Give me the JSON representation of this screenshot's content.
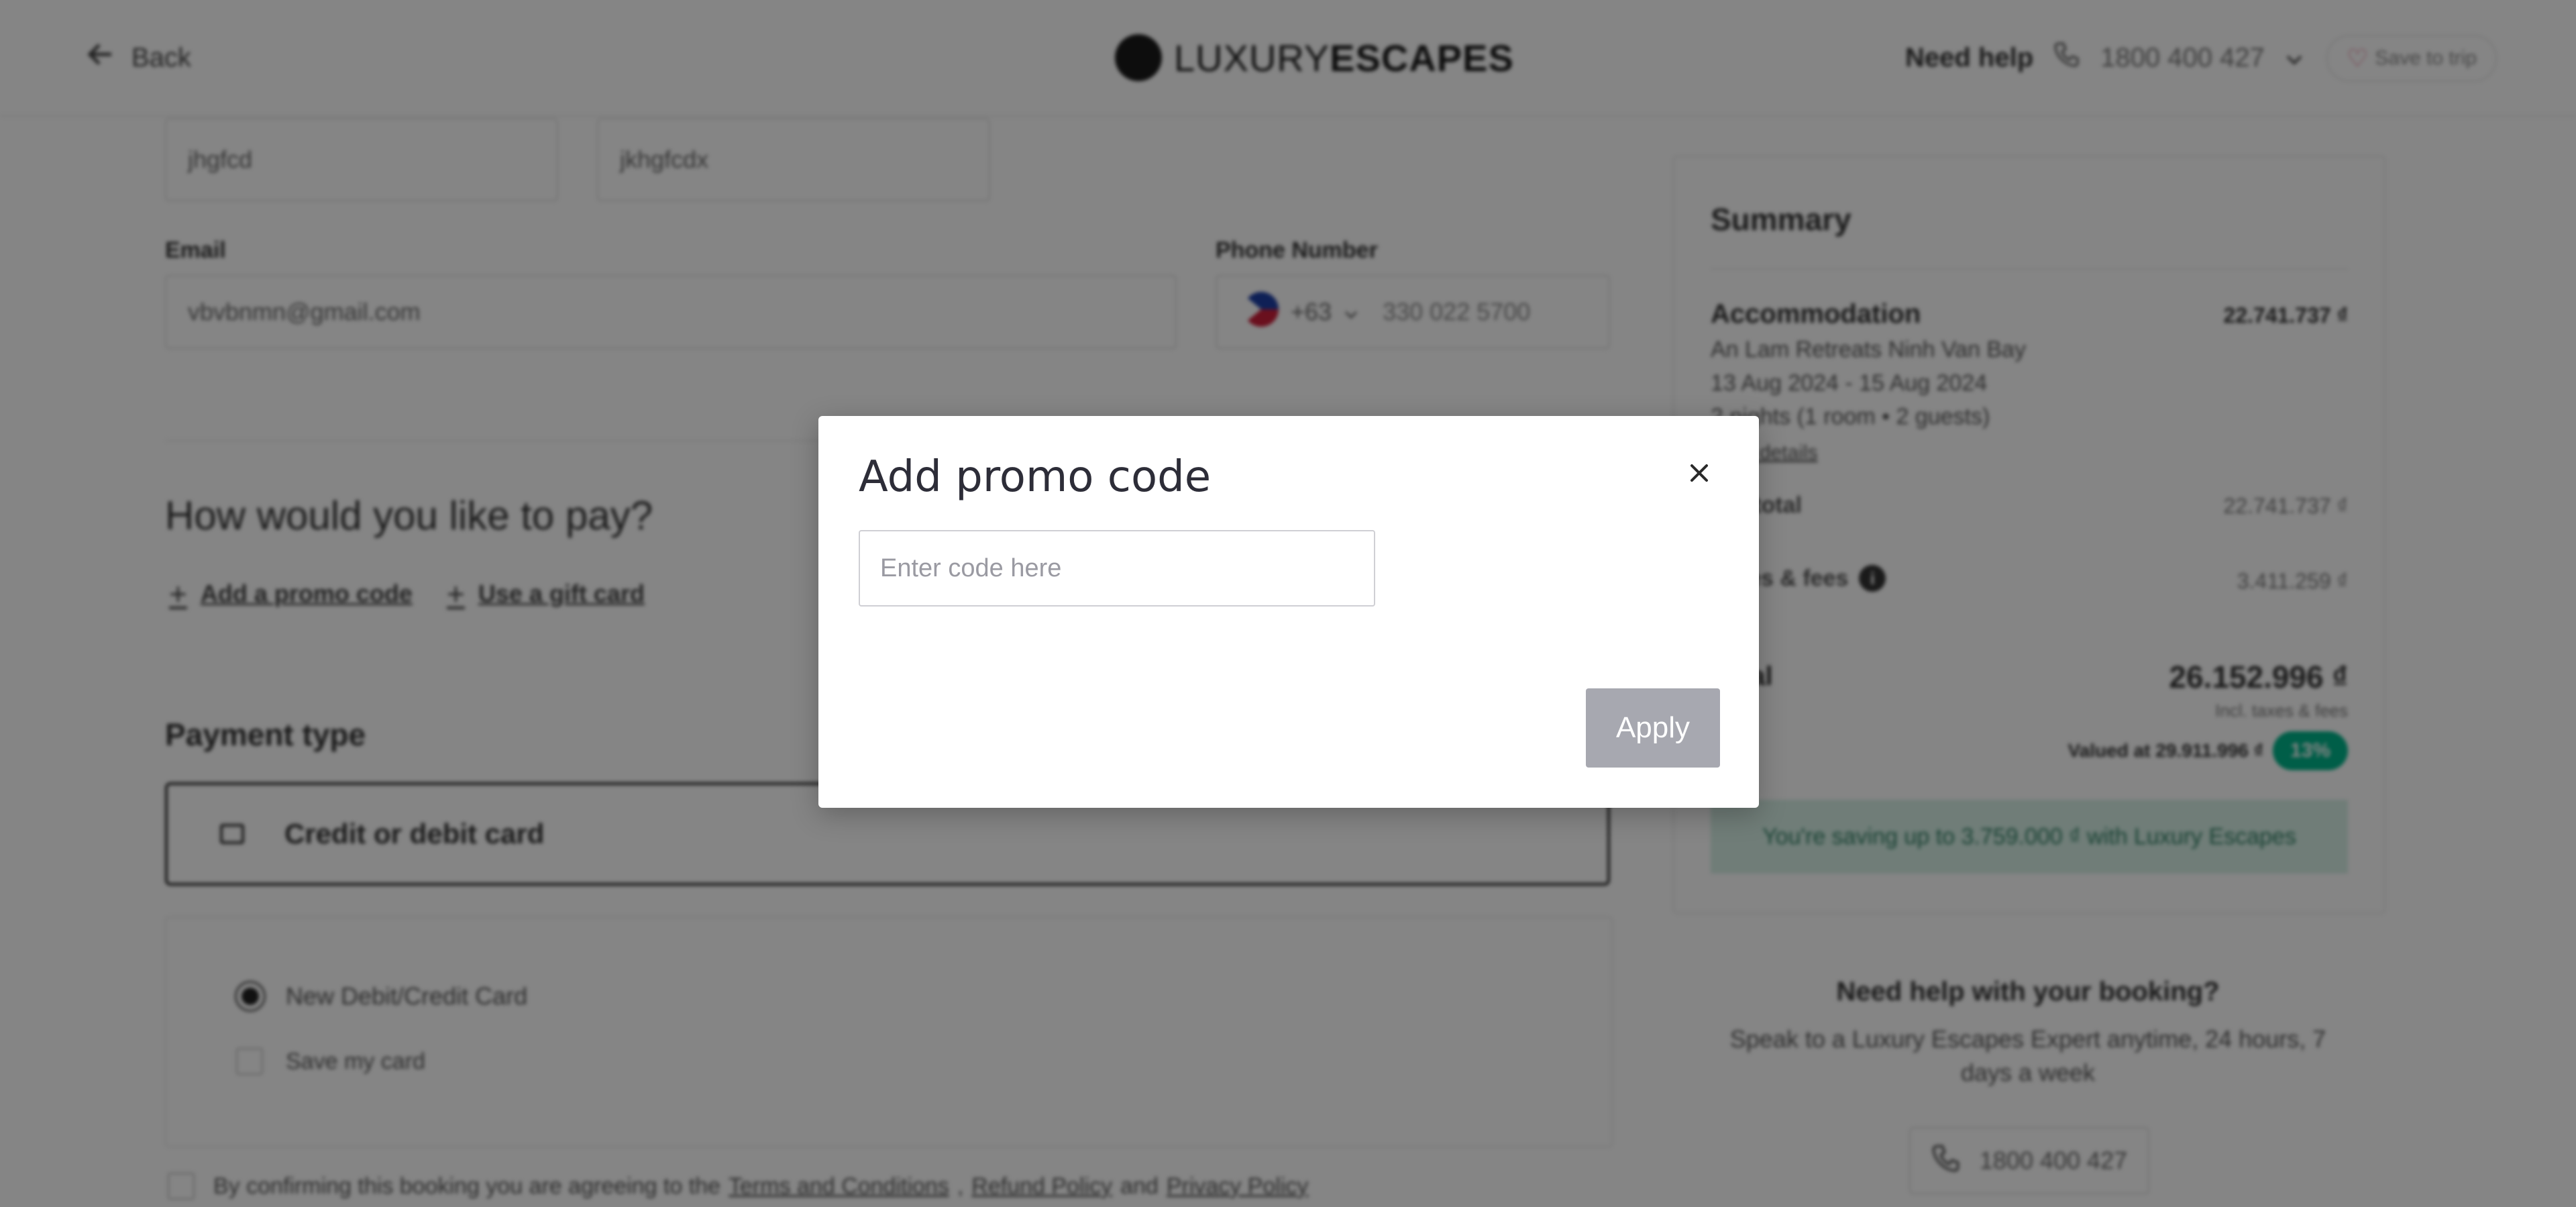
{
  "header": {
    "back_label": "Back",
    "logo_light": "LUXURY",
    "logo_bold": "ESCAPES",
    "need_help": "Need help",
    "phone": "1800 400 427",
    "save_to_trip": "Save to trip"
  },
  "form": {
    "first_name_value": "jhgfcd",
    "last_name_value": "jkhgfcdx",
    "email_label": "Email",
    "email_value": "vbvbnmn@gmail.com",
    "phone_label": "Phone Number",
    "country_code": "+63",
    "phone_value": "330 022 5700"
  },
  "payment": {
    "heading": "How would you like to pay?",
    "promo_link": "Add a promo code",
    "gift_link": "Use a gift card",
    "type_heading": "Payment type",
    "card_option": "Credit or debit card",
    "new_card": "New Debit/Credit Card",
    "save_card": "Save my card",
    "consent_prefix": "By confirming this booking you are agreeing to the",
    "terms": "Terms and Conditions",
    "refund": "Refund Policy",
    "and": "and",
    "privacy": "Privacy Policy"
  },
  "summary": {
    "title": "Summary",
    "accommodation": "Accommodation",
    "accommodation_amount": "22.741.737 ₫",
    "hotel": "An Lam Retreats Ninh Van Bay",
    "dates": "13 Aug 2024 - 15 Aug 2024",
    "stay": "2 nights (1 room • 2 guests)",
    "details_link": "View details",
    "subtotal_label": "Subtotal",
    "subtotal_amount": "22.741.737 ₫",
    "taxes_label": "Taxes & fees",
    "taxes_amount": "3.411.259 ₫",
    "total_label": "Total",
    "total_amount": "26.152.996 ₫",
    "incl_note": "Incl. taxes & fees",
    "valued_at": "Valued at 29.911.996 ₫",
    "discount_badge": "13%",
    "saving_text": "You're saving up to 3.759.000 ₫ with Luxury Escapes"
  },
  "help_box": {
    "title": "Need help with your booking?",
    "text": "Speak to a Luxury Escapes Expert anytime, 24 hours, 7 days a week",
    "phone": "1800 400 427"
  },
  "modal": {
    "title": "Add promo code",
    "input_placeholder": "Enter code here",
    "apply_label": "Apply"
  }
}
